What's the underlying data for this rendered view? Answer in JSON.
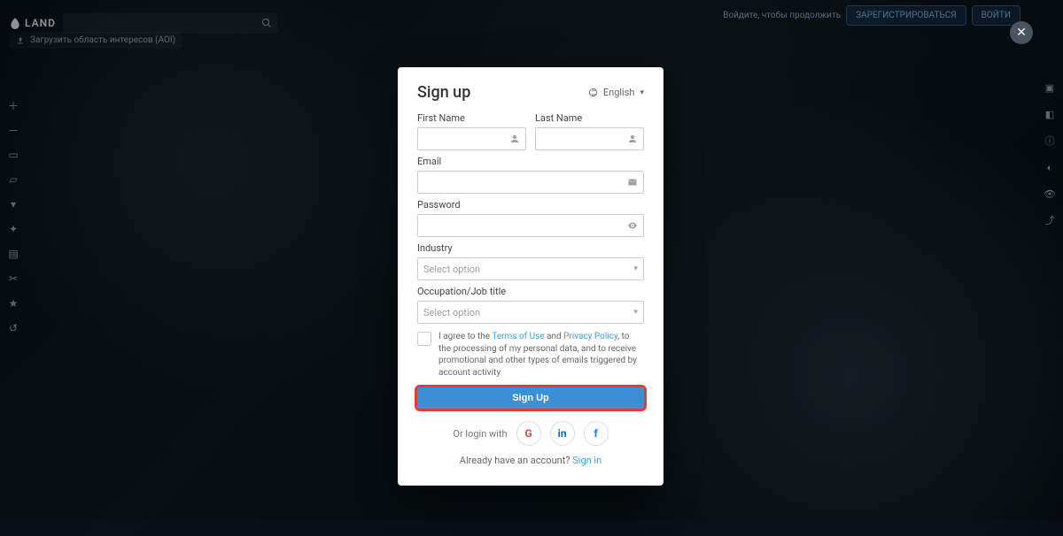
{
  "brand": "LAND",
  "top": {
    "search_placeholder": "",
    "upload_aoi": "Загрузить область интересов (AOI)",
    "signin_hint": "Войдите, чтобы продолжить",
    "register_btn": "ЗАРЕГИСТРИРОВАТЬСЯ",
    "signin_btn": "ВОЙТИ"
  },
  "modal": {
    "title": "Sign up",
    "language": "English",
    "first_name_label": "First Name",
    "last_name_label": "Last Name",
    "email_label": "Email",
    "password_label": "Password",
    "industry_label": "Industry",
    "industry_placeholder": "Select option",
    "occupation_label": "Occupation/Job title",
    "occupation_placeholder": "Select option",
    "agree_prefix": "I agree to the ",
    "terms": "Terms of Use",
    "and": " and ",
    "privacy": "Privacy Policy",
    "agree_suffix": ", to the processing of my personal data, and to receive promotional and other types of emails triggered by account activity",
    "submit": "Sign Up",
    "or_login": "Or login with",
    "already": "Already have an account?",
    "signin_link": "Sign in"
  }
}
